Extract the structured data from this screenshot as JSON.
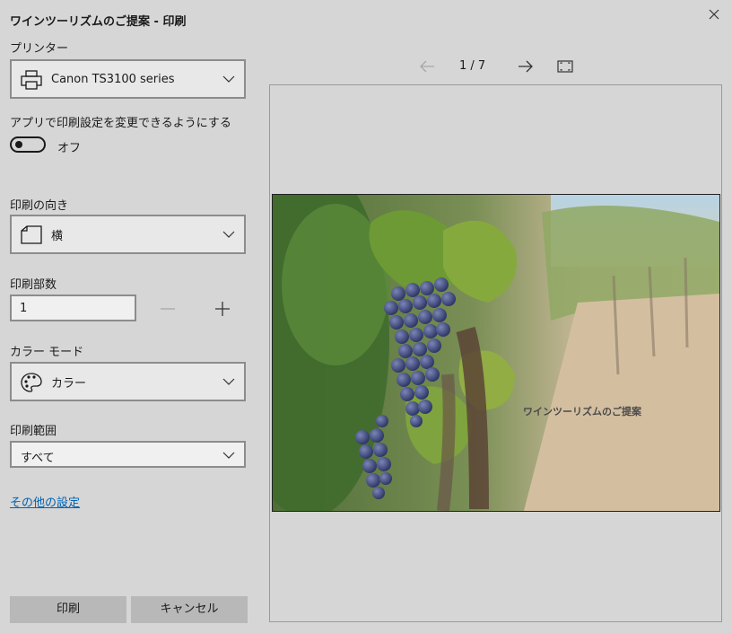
{
  "dialog": {
    "title": "ワインツーリズムのご提案 - 印刷"
  },
  "printer": {
    "label": "プリンター",
    "value": "Canon TS3100 series",
    "icon": "printer-icon"
  },
  "app_settings": {
    "label": "アプリで印刷設定を変更できるようにする",
    "toggle_state": "オフ",
    "on": false
  },
  "orientation": {
    "label": "印刷の向き",
    "value": "横",
    "icon": "page-landscape-icon"
  },
  "copies": {
    "label": "印刷部数",
    "value": "1"
  },
  "color_mode": {
    "label": "カラー モード",
    "value": "カラー",
    "icon": "palette-icon"
  },
  "print_range": {
    "label": "印刷範囲",
    "value": "すべて"
  },
  "more_settings": {
    "label": "その他の設定"
  },
  "buttons": {
    "print": "印刷",
    "cancel": "キャンセル"
  },
  "preview": {
    "page_indicator": "1 / 7",
    "slide_text": "ワインツーリズムのご提案"
  }
}
